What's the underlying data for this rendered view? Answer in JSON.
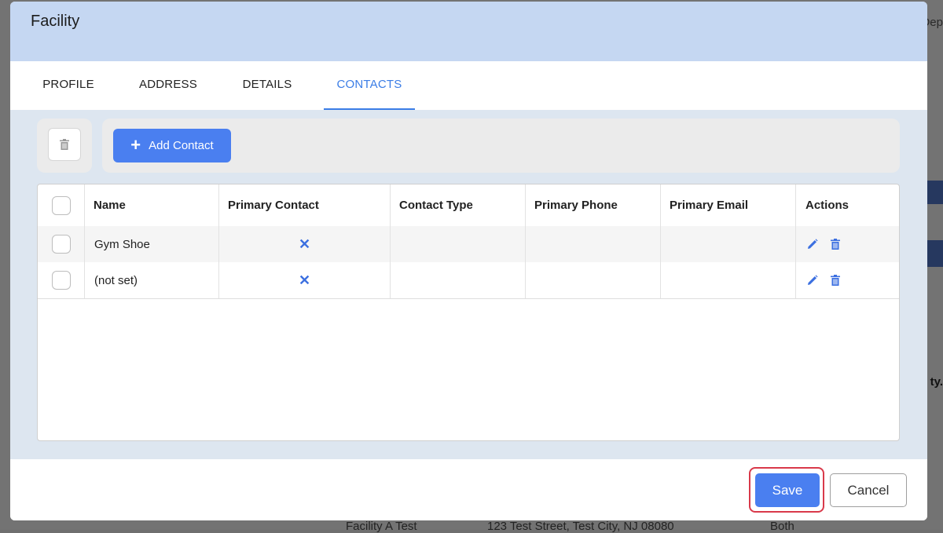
{
  "modal": {
    "title": "Facility",
    "tabs": [
      {
        "label": "PROFILE",
        "active": false
      },
      {
        "label": "ADDRESS",
        "active": false
      },
      {
        "label": "DETAILS",
        "active": false
      },
      {
        "label": "CONTACTS",
        "active": true
      }
    ],
    "toolbar": {
      "delete_icon": "trash-icon",
      "add_contact_label": "Add Contact",
      "add_icon": "plus-icon"
    },
    "table": {
      "columns": [
        "Name",
        "Primary Contact",
        "Contact Type",
        "Primary Phone",
        "Primary Email",
        "Actions"
      ],
      "rows": [
        {
          "name": "Gym Shoe",
          "primary_contact": "✕",
          "contact_type": "",
          "primary_phone": "",
          "primary_email": ""
        },
        {
          "name": "(not set)",
          "primary_contact": "✕",
          "contact_type": "",
          "primary_phone": "",
          "primary_email": ""
        }
      ],
      "action_icons": [
        "pencil-icon",
        "trash-icon"
      ]
    },
    "footer": {
      "save_label": "Save",
      "cancel_label": "Cancel"
    }
  },
  "background": {
    "partial_text_top": "Dep",
    "partial_text_mid": "ty.",
    "bottom_row": [
      "Facility A Test",
      "123 Test Street, Test City, NJ 08080",
      "Both"
    ]
  },
  "colors": {
    "accent": "#4a7ff0",
    "header_bg": "#c5d7f2",
    "content_bg": "#dde6f0",
    "highlight": "#d9394a"
  }
}
